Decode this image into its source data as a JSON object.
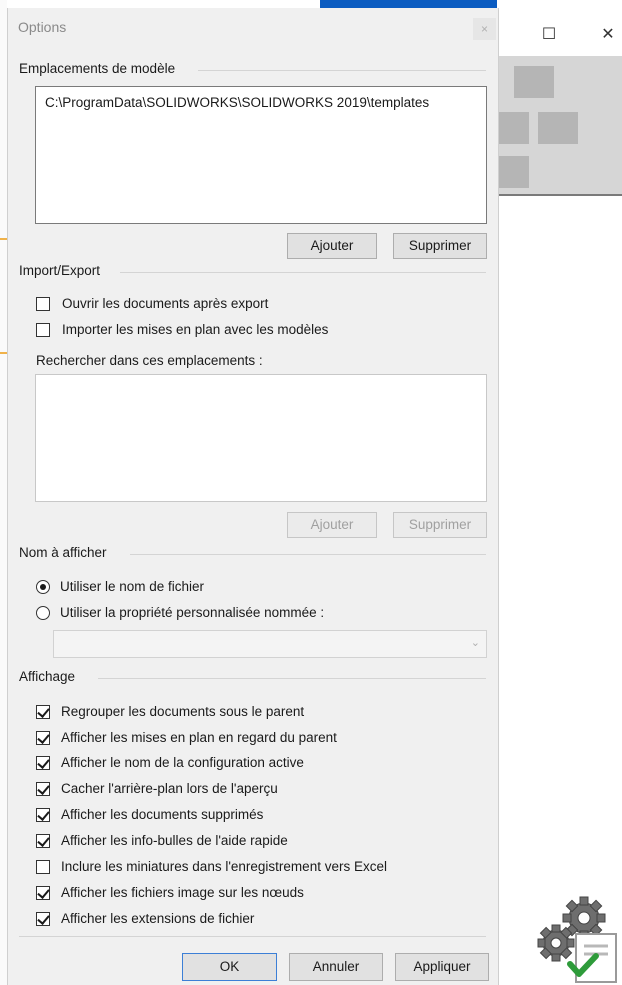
{
  "dialog": {
    "title": "Options",
    "close_glyph": "×"
  },
  "templates": {
    "group_label": "Emplacements de modèle",
    "paths": [
      "C:\\ProgramData\\SOLIDWORKS\\SOLIDWORKS 2019\\templates"
    ],
    "add_label": "Ajouter",
    "remove_label": "Supprimer"
  },
  "import_export": {
    "group_label": "Import/Export",
    "options": [
      {
        "label": "Ouvrir les documents après export",
        "checked": false
      },
      {
        "label": "Importer les mises en plan avec les modèles",
        "checked": false
      }
    ],
    "search_label": "Rechercher dans ces emplacements :",
    "add_label": "Ajouter",
    "remove_label": "Supprimer",
    "buttons_enabled": false
  },
  "display_name": {
    "group_label": "Nom à afficher",
    "options": [
      {
        "label": "Utiliser le nom de fichier",
        "selected": true
      },
      {
        "label": "Utiliser la propriété personnalisée nommée :",
        "selected": false
      }
    ],
    "property_value": "",
    "dropdown_icon": "chevron-down-icon"
  },
  "affichage": {
    "group_label": "Affichage",
    "options": [
      {
        "label": "Regrouper les documents sous le parent",
        "checked": true
      },
      {
        "label": "Afficher les mises en plan en regard du parent",
        "checked": true
      },
      {
        "label": "Afficher le nom de la configuration active",
        "checked": true
      },
      {
        "label": "Cacher l'arrière-plan lors de l'aperçu",
        "checked": true
      },
      {
        "label": "Afficher les documents supprimés",
        "checked": true
      },
      {
        "label": "Afficher les info-bulles de l'aide rapide",
        "checked": true
      },
      {
        "label": "Inclure les miniatures dans l'enregistrement vers Excel",
        "checked": false
      },
      {
        "label": "Afficher les fichiers image sur les nœuds",
        "checked": true
      },
      {
        "label": "Afficher les extensions de fichier",
        "checked": true
      }
    ]
  },
  "footer": {
    "ok_label": "OK",
    "cancel_label": "Annuler",
    "apply_label": "Appliquer"
  },
  "background_window": {
    "maximize_glyph": "☐",
    "close_glyph": "✕"
  },
  "colors": {
    "accent": "#0b5cc1",
    "dialog_bg": "#f0f0f0",
    "check_green": "#2e9b3a"
  },
  "icons": [
    "gears-settings-icon"
  ]
}
